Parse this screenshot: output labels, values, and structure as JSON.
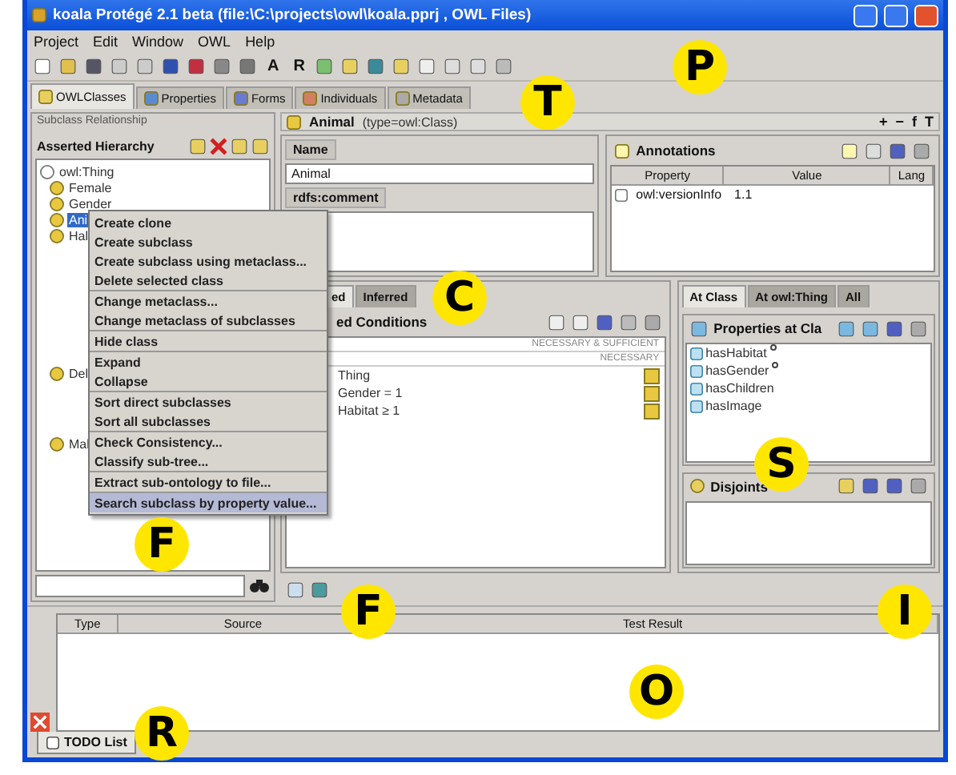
{
  "window": {
    "title": "koala  Protégé 2.1 beta    (file:\\C:\\projects\\owl\\koala.pprj , OWL Files)"
  },
  "menu_bar": [
    "Project",
    "Edit",
    "Window",
    "OWL",
    "Help"
  ],
  "toolbar": {
    "letter_buttons": [
      "A",
      "R"
    ]
  },
  "tabs": [
    {
      "label": "OWLClasses",
      "selected": true
    },
    {
      "label": "Properties",
      "selected": false
    },
    {
      "label": "Forms",
      "selected": false
    },
    {
      "label": "Individuals",
      "selected": false
    },
    {
      "label": "Metadata",
      "selected": false
    }
  ],
  "class_browser": {
    "title": "Subclass Relationship",
    "hierarchy_title": "Asserted Hierarchy",
    "tree": [
      {
        "label": "owl:Thing",
        "selected": false,
        "children": [
          {
            "label": "Female",
            "selected": false
          },
          {
            "label": "Gender",
            "selected": false
          },
          {
            "label": "Ani",
            "selected": true
          },
          {
            "label": "Hal",
            "selected": false
          },
          {
            "label": "Del",
            "selected": false
          },
          {
            "label": "Mal",
            "selected": false
          }
        ]
      }
    ]
  },
  "context_menu": {
    "groups": [
      [
        {
          "label": "Create clone",
          "selected": false
        },
        {
          "label": "Create subclass",
          "selected": false
        },
        {
          "label": "Create subclass using metaclass...",
          "selected": false
        },
        {
          "label": "Delete selected class",
          "selected": false
        }
      ],
      [
        {
          "label": "Change metaclass...",
          "selected": false
        },
        {
          "label": "Change metaclass of subclasses",
          "selected": false
        }
      ],
      [
        {
          "label": "Hide class",
          "selected": false
        }
      ],
      [
        {
          "label": "Expand",
          "selected": false
        },
        {
          "label": "Collapse",
          "selected": false
        }
      ],
      [
        {
          "label": "Sort direct subclasses",
          "selected": false
        },
        {
          "label": "Sort all subclasses",
          "selected": false
        }
      ],
      [
        {
          "label": "Check Consistency...",
          "selected": false
        },
        {
          "label": "Classify sub-tree...",
          "selected": false
        }
      ],
      [
        {
          "label": "Extract sub-ontology to file...",
          "selected": false
        }
      ],
      [
        {
          "label": "Search subclass by property value...",
          "selected": true
        }
      ]
    ]
  },
  "class_header": {
    "title": "Animal",
    "type": "(type=owl:Class)",
    "actions": [
      "+",
      "−",
      "f",
      "T"
    ]
  },
  "name_field": {
    "label": "Name",
    "value": "Animal"
  },
  "comment": {
    "label": "rdfs:comment"
  },
  "annotations": {
    "title": "Annotations",
    "columns": [
      "Property",
      "Value",
      "Lang"
    ],
    "rows": [
      {
        "property": "owl:versionInfo",
        "value": "1.1"
      }
    ]
  },
  "conditions": {
    "tabs": [
      {
        "label": "ed",
        "selected": true
      },
      {
        "label": "Inferred",
        "selected": false
      }
    ],
    "title": "ed Conditions",
    "section_labels": [
      "NECESSARY & SUFFICIENT",
      "NECESSARY"
    ],
    "rows": [
      "Thing",
      "Gender = 1",
      "Habitat ≥ 1"
    ]
  },
  "properties": {
    "tabs": [
      {
        "label": "At Class",
        "selected": true
      },
      {
        "label": "At owl:Thing",
        "selected": false
      },
      {
        "label": "All",
        "selected": false
      }
    ],
    "title": "Properties at Cla",
    "items": [
      {
        "label": "hasHabitat",
        "flagged": true
      },
      {
        "label": "hasGender",
        "flagged": true
      },
      {
        "label": "hasChildren",
        "flagged": false
      },
      {
        "label": "hasImage",
        "flagged": false
      }
    ]
  },
  "disjoints": {
    "title": "Disjoints"
  },
  "results": {
    "columns": [
      "Type",
      "Source",
      "Test Result"
    ]
  },
  "bottom_tabs": [
    {
      "label": "TODO List",
      "selected": true
    }
  ],
  "callouts": [
    "P",
    "T",
    "C",
    "S",
    "F",
    "F",
    "I",
    "O",
    "R"
  ]
}
